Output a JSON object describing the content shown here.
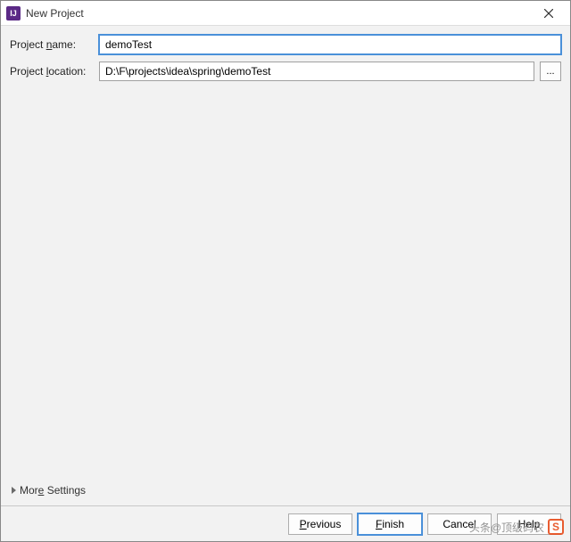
{
  "window": {
    "title": "New Project",
    "app_icon_letter": "IJ"
  },
  "form": {
    "project_name_label": "Project name:",
    "project_name_value": "demoTest",
    "project_location_label": "Project location:",
    "project_location_value": "D:\\F\\projects\\idea\\spring\\demoTest",
    "browse_label": "..."
  },
  "more_settings_label": "More Settings",
  "buttons": {
    "previous": "Previous",
    "finish": "Finish",
    "cancel": "Cancel",
    "help": "Help"
  },
  "watermark": {
    "text": "头条@顶级码农",
    "logo_letter": "S"
  }
}
